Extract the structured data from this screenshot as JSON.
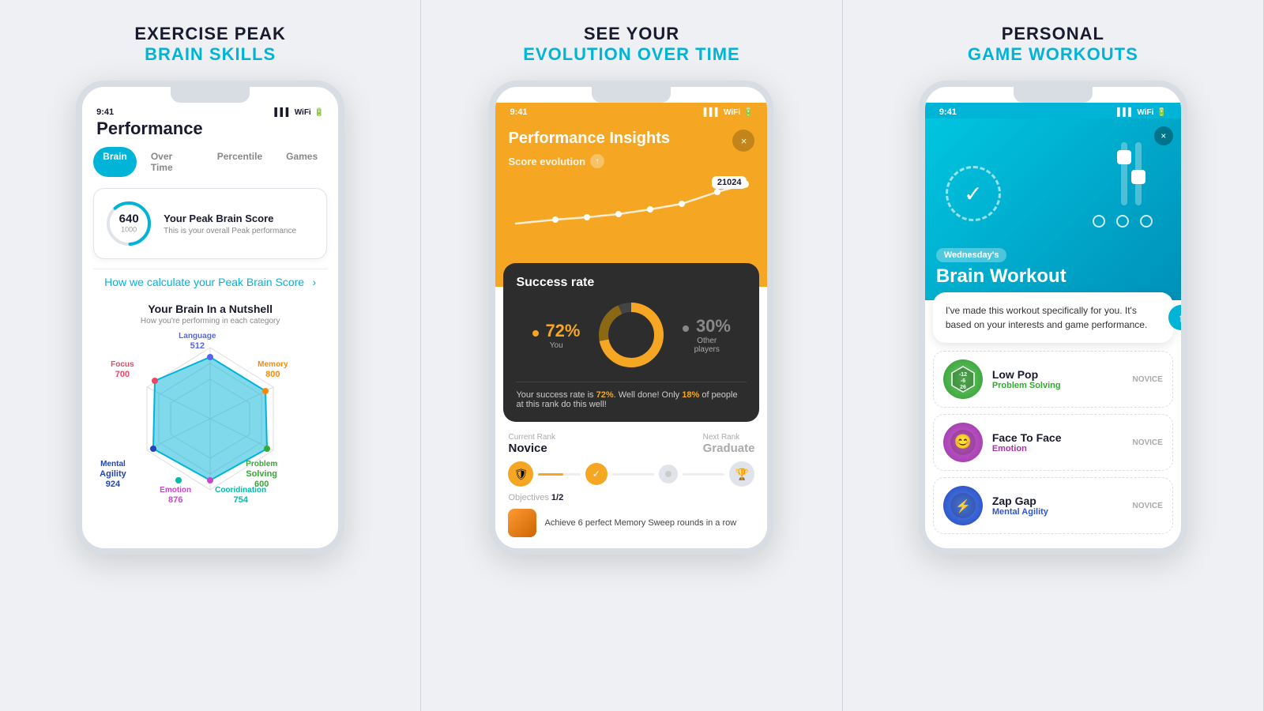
{
  "panel1": {
    "header_top": "EXERCISE PEAK",
    "header_bottom": "BRAIN SKILLS",
    "status_time": "9:41",
    "title": "Performance",
    "tabs": [
      "Brain",
      "Over Time",
      "Percentile",
      "Games"
    ],
    "active_tab": "Brain",
    "score_card": {
      "score": "640",
      "max": "1000",
      "heading": "Your Peak Brain Score",
      "desc": "This is your overall Peak performance",
      "link": "How we calculate your Peak Brain Score"
    },
    "nutshell_title": "Your Brain In a Nutshell",
    "nutshell_sub": "How you're performing in each category",
    "radar": {
      "language": {
        "label": "Language",
        "value": "512",
        "color": "#5566ee"
      },
      "focus": {
        "label": "Focus",
        "value": "700",
        "color": "#ee4466"
      },
      "memory": {
        "label": "Memory",
        "value": "800",
        "color": "#ff8800"
      },
      "mental_agility": {
        "label": "Mental\nAgility",
        "value": "924",
        "color": "#2244bb"
      },
      "problem_solving": {
        "label": "Problem\nSolving",
        "value": "600",
        "color": "#33aa33"
      },
      "emotion": {
        "label": "Emotion",
        "value": "876",
        "color": "#cc44cc"
      },
      "coordination": {
        "label": "Cooridination",
        "value": "754",
        "color": "#00bbaa"
      }
    }
  },
  "panel2": {
    "header_top": "SEE YOUR",
    "header_bottom": "EVOLUTION OVER TIME",
    "status_time": "9:41",
    "phone_header": "Performance Insights",
    "score_evo": "Score evolution",
    "score_badge": "21024",
    "success_title": "Success rate",
    "you_pct": "72%",
    "you_label": "You",
    "others_pct": "30%",
    "others_label": "Other\nplayers",
    "success_text_1": "Your success rate is ",
    "success_highlight_1": "72%",
    "success_text_2": ". Well done! Only ",
    "success_highlight_2": "18%",
    "success_text_3": " of people at this rank do this well!",
    "current_rank_label": "Current Rank",
    "current_rank": "Novice",
    "next_rank_label": "Next Rank",
    "next_rank": "Graduate",
    "objectives_label": "Objectives",
    "objectives_value": "1/2",
    "objective_desc": "Achieve 6 perfect Memory Sweep rounds in a row"
  },
  "panel3": {
    "header_top": "PERSONAL",
    "header_bottom": "GAME WORKOUTS",
    "status_time": "9:41",
    "close_label": "×",
    "day_badge": "Wednesday's",
    "workout_title": "Brain Workout",
    "chat_text": "I've made this workout specifically for you. It's based on your interests and game performance.",
    "games": [
      {
        "name": "Low Pop",
        "category": "Problem Solving",
        "level": "NOVICE",
        "icon_color": "green",
        "numbers": "-12\n-6\n26"
      },
      {
        "name": "Face To Face",
        "category": "Emotion",
        "level": "NOVICE",
        "icon_color": "purple"
      },
      {
        "name": "Zap Gap",
        "category": "Mental Agility",
        "level": "NOVICE",
        "icon_color": "blue"
      }
    ]
  }
}
